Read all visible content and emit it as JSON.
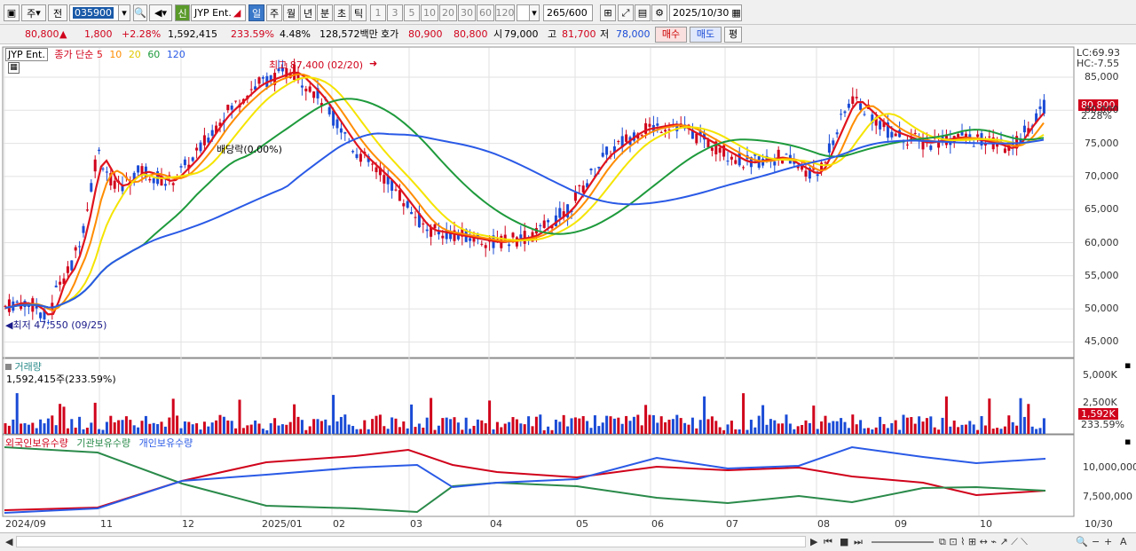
{
  "toolbar": {
    "market": "주",
    "type": "전",
    "code": "035900",
    "badge": "신",
    "name": "JYP Ent.",
    "periods": [
      "일",
      "주",
      "월",
      "년",
      "분",
      "초",
      "틱"
    ],
    "active_period": "일",
    "intervals": [
      "1",
      "3",
      "5",
      "10",
      "20",
      "30",
      "60",
      "120"
    ],
    "count": "265",
    "count_total": "/600",
    "date": "2025/10/30"
  },
  "info": {
    "price": "80,800",
    "change": "1,800",
    "change_pct": "+2.28%",
    "volume": "1,592,415",
    "volume_ratio": "233.59%",
    "turnover": "4.48%",
    "amount": "128,572백만",
    "quote_label": "호가",
    "ask": "80,900",
    "bid": "80,800",
    "open_label": "시",
    "open": "79,000",
    "high_label": "고",
    "high": "81,700",
    "low_label": "저",
    "low": "78,000",
    "buy_btn": "매수",
    "sell_btn": "매도",
    "eval_btn": "평"
  },
  "price_pane": {
    "stock_tag": "JYP Ent.",
    "legend_close": "종가 단순",
    "ma_labels": [
      "5",
      "10",
      "20",
      "60",
      "120"
    ],
    "ma_colors": [
      "#e0141e",
      "#ff8c00",
      "#f5e400",
      "#1e9a3c",
      "#2a5ae6"
    ],
    "lc": "LC:69.93",
    "hc": "HC:-7.55",
    "high_annot": "최고 87,400 (02/20)",
    "low_annot": "최저 47,550 (09/25)",
    "ex_annot": "배당락(0.00%)",
    "last_price": "80,800",
    "last_pct": "2.28%",
    "yticks": [
      "85,000",
      "80,000",
      "75,000",
      "70,000",
      "65,000",
      "60,000",
      "55,000",
      "50,000",
      "45,000"
    ]
  },
  "volume_pane": {
    "title": "거래량",
    "value": "1,592,415주(233.59%)",
    "yticks": [
      "5,000K",
      "2,500K"
    ],
    "last_vol": "1,592K",
    "last_pct": "233.59%"
  },
  "holder_pane": {
    "legend": [
      "외국인보유수량",
      "기관보유수량",
      "개인보유수량"
    ],
    "colors": [
      "#d0021b",
      "#2a8a4a",
      "#2a5ae6"
    ],
    "yticks": [
      "10,000,000",
      "7,500,000"
    ]
  },
  "x_axis": {
    "labels": [
      "2024/09",
      "11",
      "12",
      "2025/01",
      "02",
      "03",
      "04",
      "05",
      "06",
      "07",
      "08",
      "09",
      "10"
    ],
    "end_label": "10/30"
  }
}
